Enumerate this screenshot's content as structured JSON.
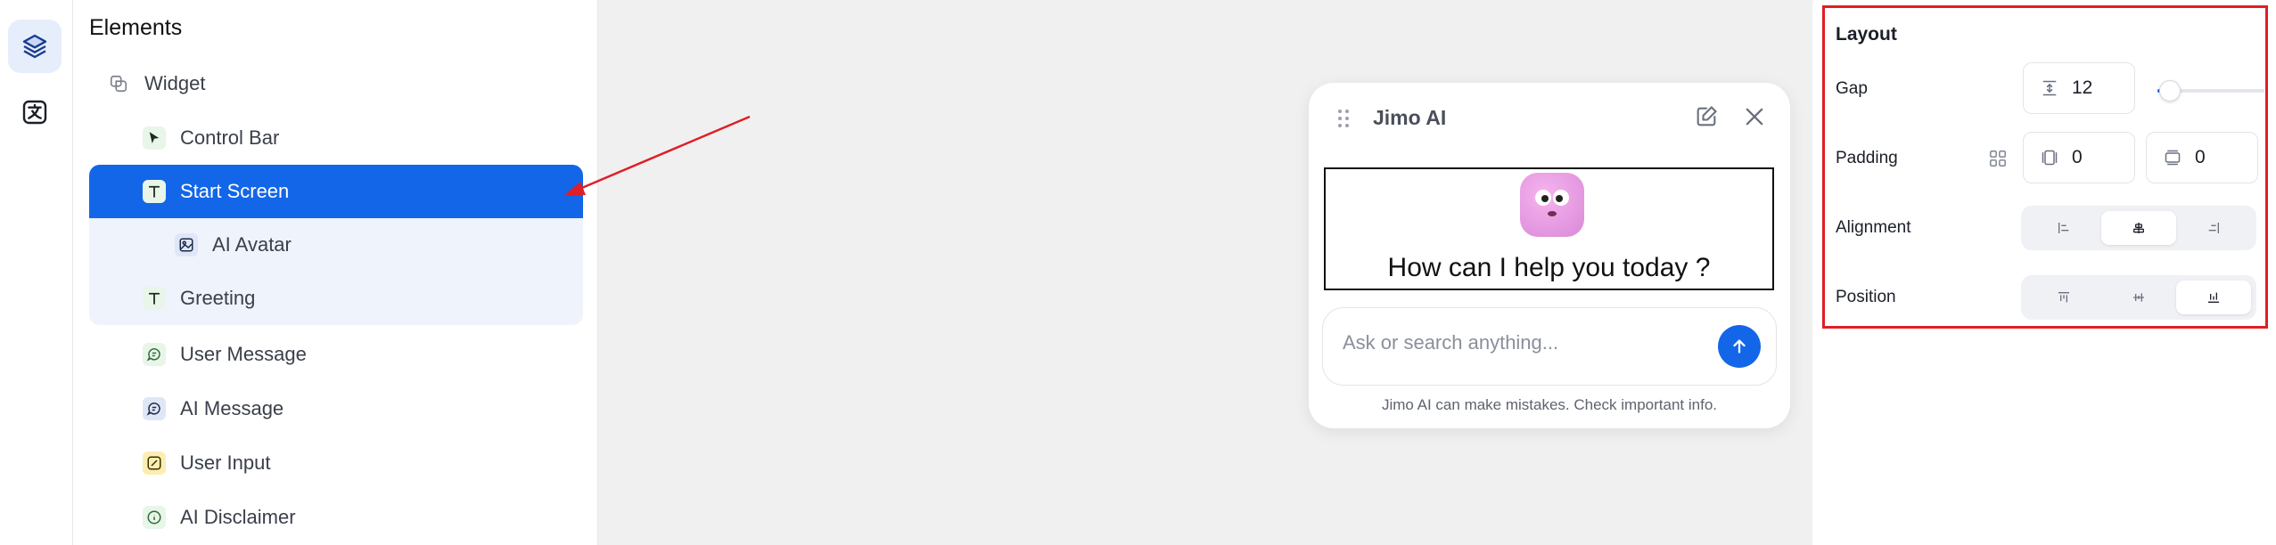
{
  "elements_panel": {
    "title": "Elements",
    "items": [
      {
        "label": "Widget",
        "icon": "widget-icon"
      },
      {
        "label": "Control Bar",
        "icon": "cursor-icon"
      },
      {
        "label": "Start Screen",
        "icon": "text-icon",
        "selected": true
      },
      {
        "label": "AI Avatar",
        "icon": "image-icon"
      },
      {
        "label": "Greeting",
        "icon": "text-icon"
      },
      {
        "label": "User Message",
        "icon": "message-icon"
      },
      {
        "label": "AI Message",
        "icon": "message-icon"
      },
      {
        "label": "User Input",
        "icon": "edit-icon"
      },
      {
        "label": "AI Disclaimer",
        "icon": "info-icon"
      }
    ]
  },
  "widget": {
    "title": "Jimo AI",
    "greeting": "How can I help you today ?",
    "input_placeholder": "Ask or search anything...",
    "disclaimer": "Jimo AI can make mistakes. Check important info."
  },
  "layout_panel": {
    "title": "Layout",
    "gap_label": "Gap",
    "gap_value": "12",
    "gap_slider_fraction": 0.12,
    "padding_label": "Padding",
    "padding_vertical": "0",
    "padding_horizontal": "0",
    "alignment_label": "Alignment",
    "alignment_selected": "center",
    "position_label": "Position",
    "position_selected": "bottom"
  },
  "colors": {
    "accent": "#1366e8",
    "highlight_border": "#e01e25",
    "arrow": "#e01e25"
  }
}
